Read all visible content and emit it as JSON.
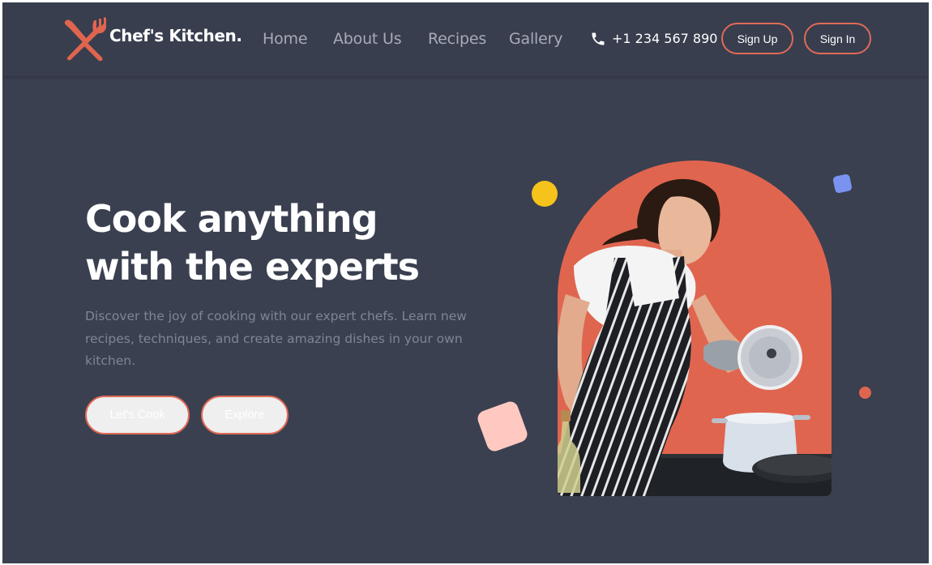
{
  "brand": {
    "name": "Chef's Kitchen.",
    "logo_icon": "utensils-icon"
  },
  "nav": {
    "links": [
      "Home",
      "About Us",
      "Recipes",
      "Gallery"
    ],
    "phone_icon": "phone-icon",
    "phone": "+1 234 567 890",
    "signup_label": "Sign Up",
    "signin_label": "Sign In"
  },
  "hero": {
    "headline_line1": "Cook anything",
    "headline_line2": "with the experts",
    "description": "Discover the joy of cooking with our expert chefs. Learn new recipes, techniques, and create amazing dishes in your own kitchen.",
    "primary_cta": "Let's Cook",
    "secondary_cta": "Explore",
    "image_icon": "chef-photo"
  },
  "colors": {
    "background": "#3a4050",
    "nav_background": "#383e4e",
    "accent": "#e0654f",
    "nav_text": "#a7abb6",
    "body_text": "#7f8593",
    "heading_text": "#ffffff",
    "dot_yellow": "#f6c21c",
    "square_blue": "#7a93f0",
    "square_pink": "#ffc9c2",
    "dot_red": "#e0654f"
  }
}
